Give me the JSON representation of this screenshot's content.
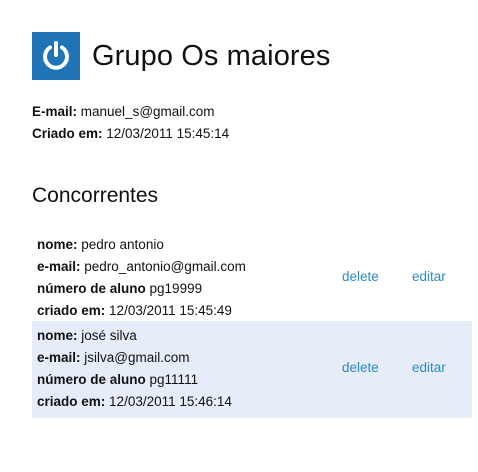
{
  "group": {
    "title": "Grupo Os maiores",
    "email_label": "E-mail:",
    "email": "manuel_s@gmail.com",
    "created_label": "Criado em:",
    "created": "12/03/2011 15:45:14"
  },
  "section": {
    "title": "Concorrentes"
  },
  "labels": {
    "name": "nome:",
    "email": "e-mail:",
    "student_number": "número de aluno",
    "created": "criado em:",
    "delete": "delete",
    "edit": "editar"
  },
  "competitors": [
    {
      "name": "pedro antonio",
      "email": "pedro_antonio@gmail.com",
      "student_number": "pg19999",
      "created": "12/03/2011 15:45:49"
    },
    {
      "name": "josé silva",
      "email": "jsilva@gmail.com",
      "student_number": "pg11111",
      "created": "12/03/2011 15:46:14"
    }
  ],
  "colors": {
    "logo_bg": "#1e74b7",
    "row_alt_bg": "#e6edf8",
    "link": "#2a8ac8"
  },
  "icons": {
    "logo": "power-icon"
  }
}
